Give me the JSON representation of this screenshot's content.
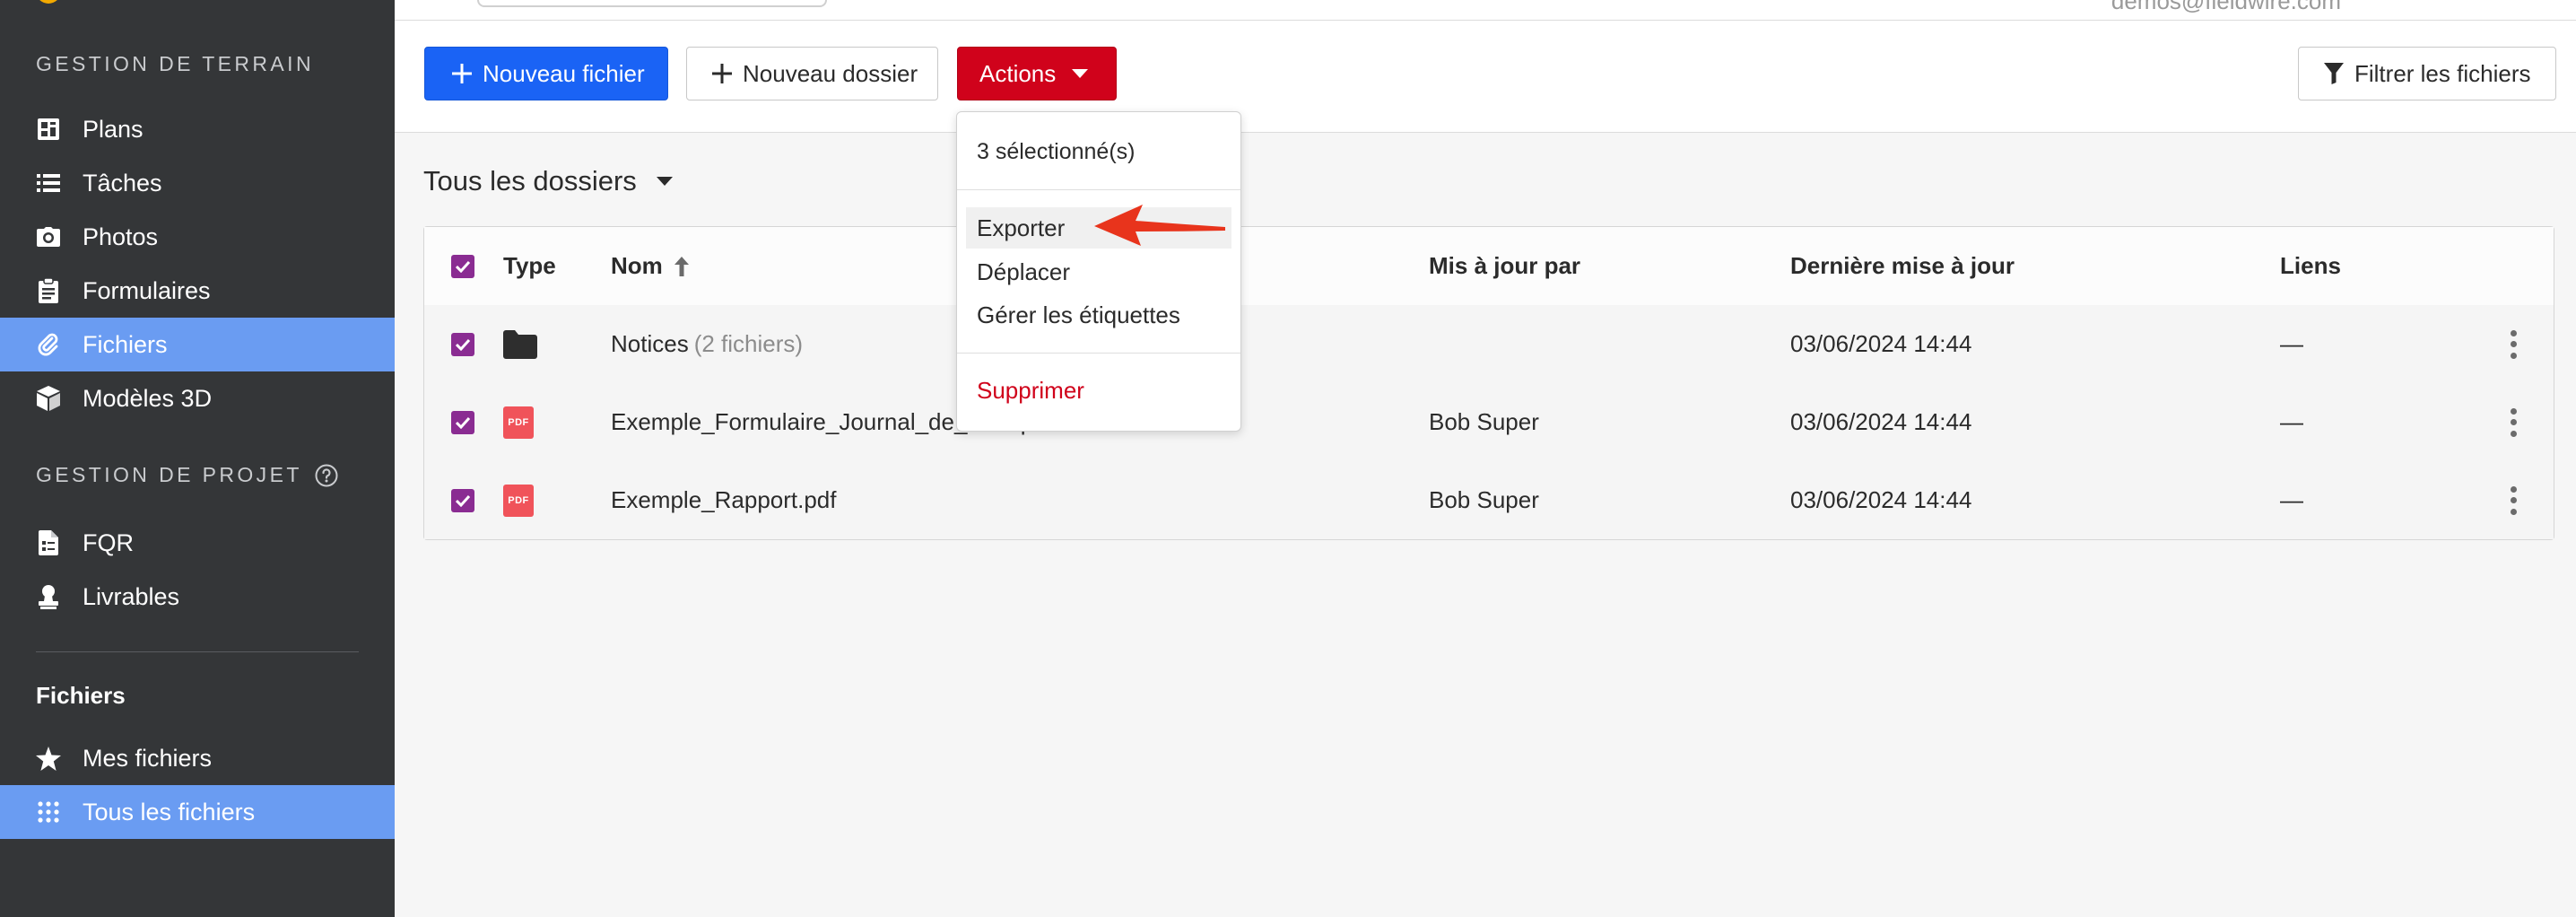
{
  "topbar": {
    "user_email": "demos@fieldwire.com"
  },
  "sidebar": {
    "section_field": "GESTION DE TERRAIN",
    "field_items": [
      {
        "label": "Plans",
        "icon": "plans-icon"
      },
      {
        "label": "Tâches",
        "icon": "tasks-list-icon"
      },
      {
        "label": "Photos",
        "icon": "camera-icon"
      },
      {
        "label": "Formulaires",
        "icon": "clipboard-icon"
      },
      {
        "label": "Fichiers",
        "icon": "paperclip-icon",
        "active": true
      },
      {
        "label": "Modèles 3D",
        "icon": "cube-icon"
      }
    ],
    "section_project": "GESTION DE PROJET",
    "project_items": [
      {
        "label": "FQR",
        "icon": "document-icon"
      },
      {
        "label": "Livrables",
        "icon": "stamp-icon"
      }
    ],
    "files_heading": "Fichiers",
    "files_items": [
      {
        "label": "Mes fichiers",
        "icon": "star-icon"
      },
      {
        "label": "Tous les fichiers",
        "icon": "grid-icon",
        "active": true
      }
    ]
  },
  "toolbar": {
    "new_file": "Nouveau fichier",
    "new_folder": "Nouveau dossier",
    "actions": "Actions",
    "filter": "Filtrer les fichiers"
  },
  "content": {
    "folder_selector": "Tous les dossiers",
    "columns": {
      "type": "Type",
      "name": "Nom",
      "updated_by": "Mis à jour par",
      "last_update": "Dernière mise à jour",
      "links": "Liens"
    },
    "rows": [
      {
        "kind": "folder",
        "name": "Notices",
        "extra": "(2 fichiers)",
        "updated_by": "",
        "date": "03/06/2024 14:44",
        "links": "—",
        "checked": true
      },
      {
        "kind": "pdf",
        "name": "Exemple_Formulaire_Journal_de_bord.pdf",
        "extra": "",
        "updated_by": "Bob Super",
        "date": "03/06/2024 14:44",
        "links": "—",
        "checked": true
      },
      {
        "kind": "pdf",
        "name": "Exemple_Rapport.pdf",
        "extra": "",
        "updated_by": "Bob Super",
        "date": "03/06/2024 14:44",
        "links": "—",
        "checked": true
      }
    ],
    "pdf_badge": "PDF"
  },
  "actions_menu": {
    "selected_count": "3 sélectionné(s)",
    "export": "Exporter",
    "move": "Déplacer",
    "manage_tags": "Gérer les étiquettes",
    "delete": "Supprimer"
  },
  "colors": {
    "sidebar_bg": "#343638",
    "sidebar_active": "#6a9cf2",
    "primary": "#1a63f5",
    "danger": "#d0021b",
    "checkbox": "#8a2c92",
    "pdf": "#f0535a",
    "annotation_arrow": "#e8341c"
  }
}
